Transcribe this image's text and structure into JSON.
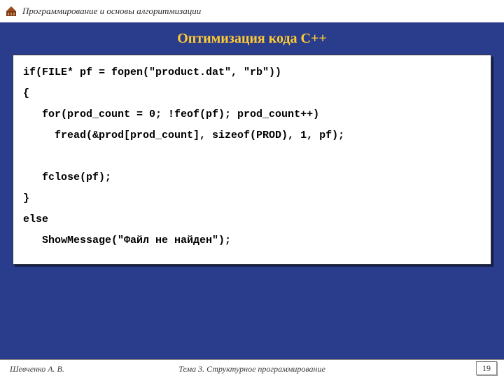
{
  "header": {
    "course_title": "Программирование и основы алгоритмизации"
  },
  "slide": {
    "title": "Оптимизация кода С++"
  },
  "code": {
    "lines": [
      "if(FILE* pf = fopen(\"product.dat\", \"rb\"))",
      "{",
      "   for(prod_count = 0; !feof(pf); prod_count++)",
      "     fread(&prod[prod_count], sizeof(PROD), 1, pf);",
      "",
      "   fclose(pf);",
      "}",
      "else",
      "   ShowMessage(\"Файл не найден\");"
    ]
  },
  "footer": {
    "author": "Шевченко А. В.",
    "topic": "Тема 3. Структурное программирование",
    "page": "19"
  }
}
